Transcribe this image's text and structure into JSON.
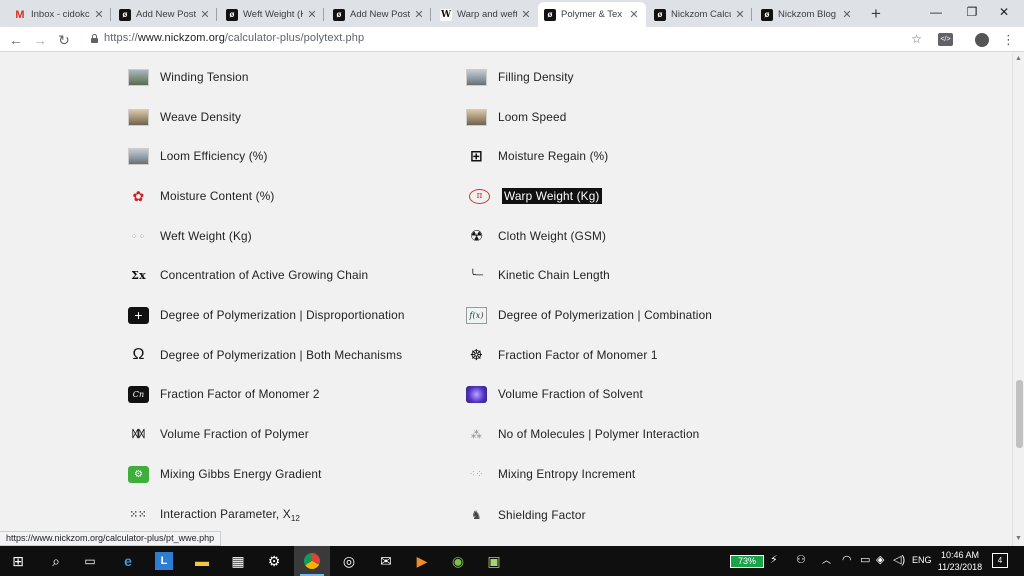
{
  "browser": {
    "tabs": [
      {
        "title": "Inbox - cidokc",
        "icon": "gmail-icon"
      },
      {
        "title": "Add New Post",
        "icon": "nickzom-icon"
      },
      {
        "title": "Weft Weight (K",
        "icon": "nickzom-icon"
      },
      {
        "title": "Add New Post",
        "icon": "nickzom-icon"
      },
      {
        "title": "Warp and weft",
        "icon": "wikipedia-icon"
      },
      {
        "title": "Polymer & Tex",
        "icon": "nickzom-icon"
      },
      {
        "title": "Nickzom Calcu",
        "icon": "nickzom-icon"
      },
      {
        "title": "Nickzom Blog",
        "icon": "nickzom-icon"
      }
    ],
    "active_tab_index": 5,
    "new_tab_symbol": "+",
    "url_scheme": "https://",
    "url_host": "www.nickzom.org",
    "url_path": "/calculator-plus/polytext.php",
    "status_url": "https://www.nickzom.org/calculator-plus/pt_wwe.php"
  },
  "calculators": {
    "left": [
      {
        "label": "Winding Tension",
        "icon": "photo-icon"
      },
      {
        "label": "Weave Density",
        "icon": "photo-icon"
      },
      {
        "label": "Loom Efficiency (%)",
        "icon": "photo-icon"
      },
      {
        "label": "Moisture Content (%)",
        "icon": "red-glyph-icon"
      },
      {
        "label": "Weft Weight (Kg)",
        "icon": "dotted-grid-icon"
      },
      {
        "label": "Concentration of Active Growing Chain",
        "icon": "sigma-icon"
      },
      {
        "label": "Degree of Polymerization | Disproportionation",
        "icon": "plus-box-icon"
      },
      {
        "label": "Degree of Polymerization | Both Mechanisms",
        "icon": "omega-icon"
      },
      {
        "label": "Fraction Factor of Monomer 2",
        "icon": "cn-box-icon"
      },
      {
        "label": "Volume Fraction of Polymer",
        "icon": "chain-icon"
      },
      {
        "label": "Mixing Gibbs Energy Gradient",
        "icon": "green-gear-icon"
      },
      {
        "label": "Interaction Parameter, X",
        "sub": "12",
        "icon": "dots-icon"
      }
    ],
    "right": [
      {
        "label": "Filling Density",
        "icon": "photo-icon"
      },
      {
        "label": "Loom Speed",
        "icon": "photo-icon"
      },
      {
        "label": "Moisture Regain (%)",
        "icon": "calculator-grid-icon"
      },
      {
        "label": "Warp Weight (Kg)",
        "icon": "pi-icon",
        "selected": true
      },
      {
        "label": "Cloth Weight (GSM)",
        "icon": "radiation-icon"
      },
      {
        "label": "Kinetic Chain Length",
        "icon": "curve-icon"
      },
      {
        "label": "Degree of Polymerization | Combination",
        "icon": "fx-icon"
      },
      {
        "label": "Fraction Factor of Monomer 1",
        "icon": "ferris-wheel-icon"
      },
      {
        "label": "Volume Fraction of Solvent",
        "icon": "purple-sphere-icon"
      },
      {
        "label": "No of Molecules | Polymer Interaction",
        "icon": "molecule-icon"
      },
      {
        "label": "Mixing Entropy Increment",
        "icon": "scatter-icon"
      },
      {
        "label": "Shielding Factor",
        "icon": "shield-figure-icon"
      }
    ]
  },
  "taskbar": {
    "battery": "73%",
    "language": "ENG",
    "time": "10:46 AM",
    "date": "11/23/2018",
    "notifications": "4"
  }
}
